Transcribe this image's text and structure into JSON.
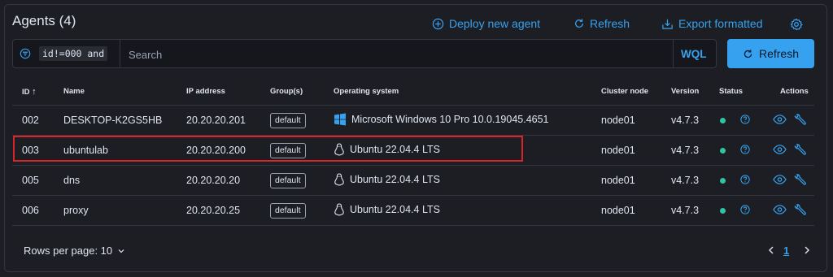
{
  "header": {
    "title": "Agents (4)",
    "deploy_label": "Deploy new agent",
    "refresh_label": "Refresh",
    "export_label": "Export formatted"
  },
  "search": {
    "query_chip": "id!=000 and",
    "placeholder": "Search",
    "wql_label": "WQL",
    "refresh_button": "Refresh"
  },
  "table": {
    "columns": {
      "id": "ID",
      "name": "Name",
      "ip": "IP address",
      "groups": "Group(s)",
      "os": "Operating system",
      "cluster": "Cluster node",
      "version": "Version",
      "status": "Status",
      "actions": "Actions"
    },
    "rows": [
      {
        "id": "002",
        "name": "DESKTOP-K2GS5HB",
        "ip": "20.20.20.201",
        "group": "default",
        "os": "Microsoft Windows 10 Pro 10.0.19045.4651",
        "os_icon": "windows-icon",
        "cluster": "node01",
        "version": "v4.7.3"
      },
      {
        "id": "003",
        "name": "ubuntulab",
        "ip": "20.20.20.200",
        "group": "default",
        "os": "Ubuntu 22.04.4 LTS",
        "os_icon": "linux-icon",
        "cluster": "node01",
        "version": "v4.7.3"
      },
      {
        "id": "005",
        "name": "dns",
        "ip": "20.20.20.20",
        "group": "default",
        "os": "Ubuntu 22.04.4 LTS",
        "os_icon": "linux-icon",
        "cluster": "node01",
        "version": "v4.7.3"
      },
      {
        "id": "006",
        "name": "proxy",
        "ip": "20.20.20.25",
        "group": "default",
        "os": "Ubuntu 22.04.4 LTS",
        "os_icon": "linux-icon",
        "cluster": "node01",
        "version": "v4.7.3"
      }
    ]
  },
  "footer": {
    "rows_per_page": "Rows per page: 10",
    "current_page": "1"
  },
  "colors": {
    "accent": "#36a2ef",
    "status_active": "#2fc5a3",
    "highlight": "#d6262c"
  }
}
